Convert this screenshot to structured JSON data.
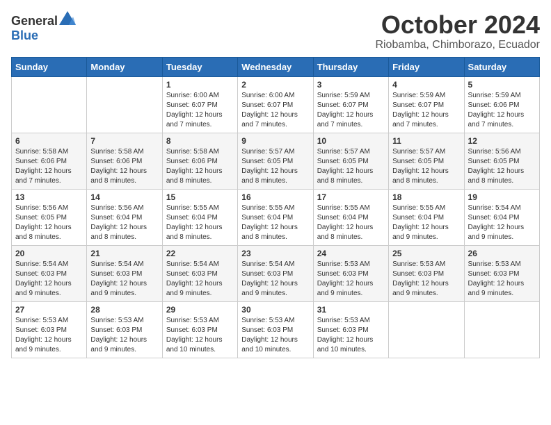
{
  "logo": {
    "general": "General",
    "blue": "Blue"
  },
  "title": {
    "month_year": "October 2024",
    "location": "Riobamba, Chimborazo, Ecuador"
  },
  "days_of_week": [
    "Sunday",
    "Monday",
    "Tuesday",
    "Wednesday",
    "Thursday",
    "Friday",
    "Saturday"
  ],
  "weeks": [
    [
      {
        "day": "",
        "sunrise": "",
        "sunset": "",
        "daylight": ""
      },
      {
        "day": "",
        "sunrise": "",
        "sunset": "",
        "daylight": ""
      },
      {
        "day": "1",
        "sunrise": "Sunrise: 6:00 AM",
        "sunset": "Sunset: 6:07 PM",
        "daylight": "Daylight: 12 hours and 7 minutes."
      },
      {
        "day": "2",
        "sunrise": "Sunrise: 6:00 AM",
        "sunset": "Sunset: 6:07 PM",
        "daylight": "Daylight: 12 hours and 7 minutes."
      },
      {
        "day": "3",
        "sunrise": "Sunrise: 5:59 AM",
        "sunset": "Sunset: 6:07 PM",
        "daylight": "Daylight: 12 hours and 7 minutes."
      },
      {
        "day": "4",
        "sunrise": "Sunrise: 5:59 AM",
        "sunset": "Sunset: 6:07 PM",
        "daylight": "Daylight: 12 hours and 7 minutes."
      },
      {
        "day": "5",
        "sunrise": "Sunrise: 5:59 AM",
        "sunset": "Sunset: 6:06 PM",
        "daylight": "Daylight: 12 hours and 7 minutes."
      }
    ],
    [
      {
        "day": "6",
        "sunrise": "Sunrise: 5:58 AM",
        "sunset": "Sunset: 6:06 PM",
        "daylight": "Daylight: 12 hours and 7 minutes."
      },
      {
        "day": "7",
        "sunrise": "Sunrise: 5:58 AM",
        "sunset": "Sunset: 6:06 PM",
        "daylight": "Daylight: 12 hours and 8 minutes."
      },
      {
        "day": "8",
        "sunrise": "Sunrise: 5:58 AM",
        "sunset": "Sunset: 6:06 PM",
        "daylight": "Daylight: 12 hours and 8 minutes."
      },
      {
        "day": "9",
        "sunrise": "Sunrise: 5:57 AM",
        "sunset": "Sunset: 6:05 PM",
        "daylight": "Daylight: 12 hours and 8 minutes."
      },
      {
        "day": "10",
        "sunrise": "Sunrise: 5:57 AM",
        "sunset": "Sunset: 6:05 PM",
        "daylight": "Daylight: 12 hours and 8 minutes."
      },
      {
        "day": "11",
        "sunrise": "Sunrise: 5:57 AM",
        "sunset": "Sunset: 6:05 PM",
        "daylight": "Daylight: 12 hours and 8 minutes."
      },
      {
        "day": "12",
        "sunrise": "Sunrise: 5:56 AM",
        "sunset": "Sunset: 6:05 PM",
        "daylight": "Daylight: 12 hours and 8 minutes."
      }
    ],
    [
      {
        "day": "13",
        "sunrise": "Sunrise: 5:56 AM",
        "sunset": "Sunset: 6:05 PM",
        "daylight": "Daylight: 12 hours and 8 minutes."
      },
      {
        "day": "14",
        "sunrise": "Sunrise: 5:56 AM",
        "sunset": "Sunset: 6:04 PM",
        "daylight": "Daylight: 12 hours and 8 minutes."
      },
      {
        "day": "15",
        "sunrise": "Sunrise: 5:55 AM",
        "sunset": "Sunset: 6:04 PM",
        "daylight": "Daylight: 12 hours and 8 minutes."
      },
      {
        "day": "16",
        "sunrise": "Sunrise: 5:55 AM",
        "sunset": "Sunset: 6:04 PM",
        "daylight": "Daylight: 12 hours and 8 minutes."
      },
      {
        "day": "17",
        "sunrise": "Sunrise: 5:55 AM",
        "sunset": "Sunset: 6:04 PM",
        "daylight": "Daylight: 12 hours and 8 minutes."
      },
      {
        "day": "18",
        "sunrise": "Sunrise: 5:55 AM",
        "sunset": "Sunset: 6:04 PM",
        "daylight": "Daylight: 12 hours and 9 minutes."
      },
      {
        "day": "19",
        "sunrise": "Sunrise: 5:54 AM",
        "sunset": "Sunset: 6:04 PM",
        "daylight": "Daylight: 12 hours and 9 minutes."
      }
    ],
    [
      {
        "day": "20",
        "sunrise": "Sunrise: 5:54 AM",
        "sunset": "Sunset: 6:03 PM",
        "daylight": "Daylight: 12 hours and 9 minutes."
      },
      {
        "day": "21",
        "sunrise": "Sunrise: 5:54 AM",
        "sunset": "Sunset: 6:03 PM",
        "daylight": "Daylight: 12 hours and 9 minutes."
      },
      {
        "day": "22",
        "sunrise": "Sunrise: 5:54 AM",
        "sunset": "Sunset: 6:03 PM",
        "daylight": "Daylight: 12 hours and 9 minutes."
      },
      {
        "day": "23",
        "sunrise": "Sunrise: 5:54 AM",
        "sunset": "Sunset: 6:03 PM",
        "daylight": "Daylight: 12 hours and 9 minutes."
      },
      {
        "day": "24",
        "sunrise": "Sunrise: 5:53 AM",
        "sunset": "Sunset: 6:03 PM",
        "daylight": "Daylight: 12 hours and 9 minutes."
      },
      {
        "day": "25",
        "sunrise": "Sunrise: 5:53 AM",
        "sunset": "Sunset: 6:03 PM",
        "daylight": "Daylight: 12 hours and 9 minutes."
      },
      {
        "day": "26",
        "sunrise": "Sunrise: 5:53 AM",
        "sunset": "Sunset: 6:03 PM",
        "daylight": "Daylight: 12 hours and 9 minutes."
      }
    ],
    [
      {
        "day": "27",
        "sunrise": "Sunrise: 5:53 AM",
        "sunset": "Sunset: 6:03 PM",
        "daylight": "Daylight: 12 hours and 9 minutes."
      },
      {
        "day": "28",
        "sunrise": "Sunrise: 5:53 AM",
        "sunset": "Sunset: 6:03 PM",
        "daylight": "Daylight: 12 hours and 9 minutes."
      },
      {
        "day": "29",
        "sunrise": "Sunrise: 5:53 AM",
        "sunset": "Sunset: 6:03 PM",
        "daylight": "Daylight: 12 hours and 10 minutes."
      },
      {
        "day": "30",
        "sunrise": "Sunrise: 5:53 AM",
        "sunset": "Sunset: 6:03 PM",
        "daylight": "Daylight: 12 hours and 10 minutes."
      },
      {
        "day": "31",
        "sunrise": "Sunrise: 5:53 AM",
        "sunset": "Sunset: 6:03 PM",
        "daylight": "Daylight: 12 hours and 10 minutes."
      },
      {
        "day": "",
        "sunrise": "",
        "sunset": "",
        "daylight": ""
      },
      {
        "day": "",
        "sunrise": "",
        "sunset": "",
        "daylight": ""
      }
    ]
  ]
}
